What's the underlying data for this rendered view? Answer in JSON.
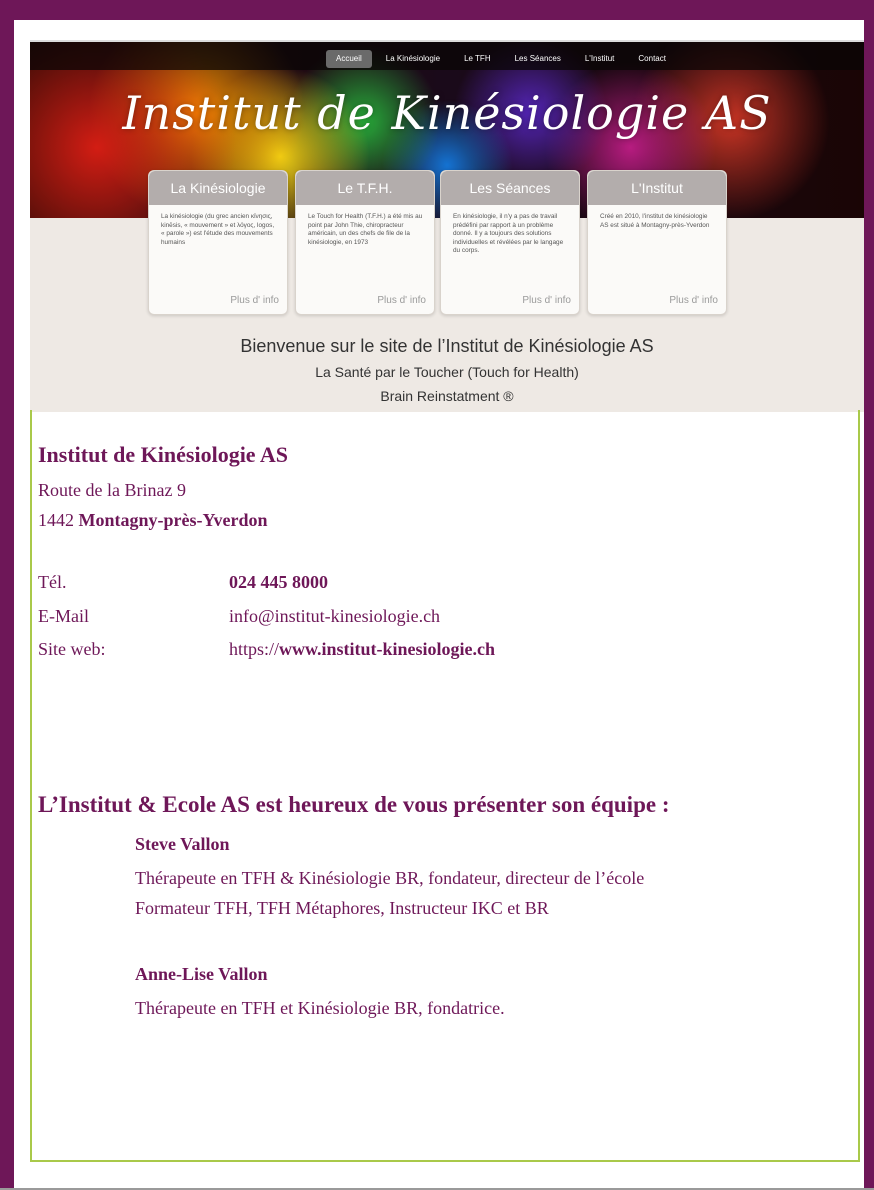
{
  "banner": {
    "nav": [
      "Accueil",
      "La Kinésiologie",
      "Le TFH",
      "Les Séances",
      "L'Institut",
      "Contact"
    ],
    "title": "Institut de Kinésiologie AS",
    "cards": [
      {
        "title": "La Kinésiologie",
        "text": "La kinésiologie (du grec ancien κίνησις, kinēsis, « mouvement » et λόγος, logos, « parole ») est l'étude des mouvements humains",
        "more": "Plus d' info"
      },
      {
        "title": "Le T.F.H.",
        "text": "Le Touch for Health (T.F.H.) a été mis au point par John Thie, chiropracteur américain, un des chefs de file de la kinésiologie, en 1973",
        "more": "Plus d' info"
      },
      {
        "title": "Les Séances",
        "text": "En kinésiologie, il n'y a pas de travail prédéfini par rapport à un problème donné. Il y a toujours des solutions individuelles et révélées par le langage du corps.",
        "more": "Plus d' info"
      },
      {
        "title": "L'Institut",
        "text": "Créé en 2010, l'institut de kinésiologie AS est situé à Montagny-près-Yverdon",
        "more": "Plus d' info"
      }
    ],
    "welcome": "Bienvenue sur le site de l’Institut de Kinésiologie AS",
    "tagline": "La Santé par le Toucher (Touch for Health)",
    "brain": "Brain Reinstatment ®"
  },
  "institute": {
    "name": "Institut de Kinésiologie AS",
    "street": "Route de la Brinaz 9",
    "zip": "1442",
    "city": "Montagny-près-Yverdon"
  },
  "contact": {
    "phone_label": "Tél.",
    "phone": "024 445 8000",
    "email_label": "E-Mail",
    "email": "info@institut-kinesiologie.ch",
    "web_label": "Site web:",
    "web_prefix": "https://",
    "web_domain": "www.institut-kinesiologie.ch"
  },
  "team": {
    "heading": "L’Institut & Ecole AS est heureux de vous présenter son équipe :",
    "members": [
      {
        "name": "Steve Vallon",
        "line1": "Thérapeute en TFH & Kinésiologie BR, fondateur, directeur de l’école",
        "line2": "Formateur TFH, TFH Métaphores, Instructeur IKC et BR"
      },
      {
        "name": "Anne-Lise Vallon",
        "line1": "Thérapeute en TFH et Kinésiologie BR, fondatrice."
      }
    ]
  }
}
